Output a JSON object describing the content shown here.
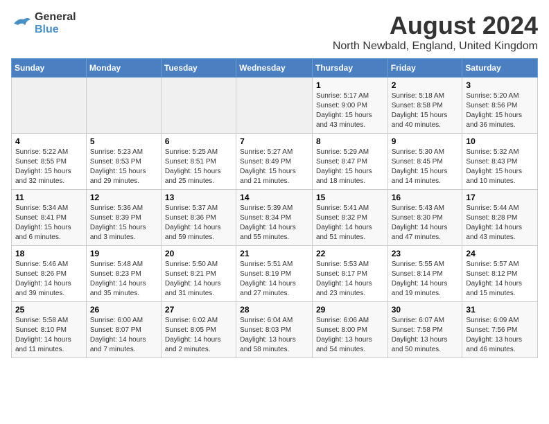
{
  "logo": {
    "line1": "General",
    "line2": "Blue"
  },
  "title": "August 2024",
  "location": "North Newbald, England, United Kingdom",
  "weekdays": [
    "Sunday",
    "Monday",
    "Tuesday",
    "Wednesday",
    "Thursday",
    "Friday",
    "Saturday"
  ],
  "weeks": [
    [
      {
        "day": "",
        "info": ""
      },
      {
        "day": "",
        "info": ""
      },
      {
        "day": "",
        "info": ""
      },
      {
        "day": "",
        "info": ""
      },
      {
        "day": "1",
        "info": "Sunrise: 5:17 AM\nSunset: 9:00 PM\nDaylight: 15 hours\nand 43 minutes."
      },
      {
        "day": "2",
        "info": "Sunrise: 5:18 AM\nSunset: 8:58 PM\nDaylight: 15 hours\nand 40 minutes."
      },
      {
        "day": "3",
        "info": "Sunrise: 5:20 AM\nSunset: 8:56 PM\nDaylight: 15 hours\nand 36 minutes."
      }
    ],
    [
      {
        "day": "4",
        "info": "Sunrise: 5:22 AM\nSunset: 8:55 PM\nDaylight: 15 hours\nand 32 minutes."
      },
      {
        "day": "5",
        "info": "Sunrise: 5:23 AM\nSunset: 8:53 PM\nDaylight: 15 hours\nand 29 minutes."
      },
      {
        "day": "6",
        "info": "Sunrise: 5:25 AM\nSunset: 8:51 PM\nDaylight: 15 hours\nand 25 minutes."
      },
      {
        "day": "7",
        "info": "Sunrise: 5:27 AM\nSunset: 8:49 PM\nDaylight: 15 hours\nand 21 minutes."
      },
      {
        "day": "8",
        "info": "Sunrise: 5:29 AM\nSunset: 8:47 PM\nDaylight: 15 hours\nand 18 minutes."
      },
      {
        "day": "9",
        "info": "Sunrise: 5:30 AM\nSunset: 8:45 PM\nDaylight: 15 hours\nand 14 minutes."
      },
      {
        "day": "10",
        "info": "Sunrise: 5:32 AM\nSunset: 8:43 PM\nDaylight: 15 hours\nand 10 minutes."
      }
    ],
    [
      {
        "day": "11",
        "info": "Sunrise: 5:34 AM\nSunset: 8:41 PM\nDaylight: 15 hours\nand 6 minutes."
      },
      {
        "day": "12",
        "info": "Sunrise: 5:36 AM\nSunset: 8:39 PM\nDaylight: 15 hours\nand 3 minutes."
      },
      {
        "day": "13",
        "info": "Sunrise: 5:37 AM\nSunset: 8:36 PM\nDaylight: 14 hours\nand 59 minutes."
      },
      {
        "day": "14",
        "info": "Sunrise: 5:39 AM\nSunset: 8:34 PM\nDaylight: 14 hours\nand 55 minutes."
      },
      {
        "day": "15",
        "info": "Sunrise: 5:41 AM\nSunset: 8:32 PM\nDaylight: 14 hours\nand 51 minutes."
      },
      {
        "day": "16",
        "info": "Sunrise: 5:43 AM\nSunset: 8:30 PM\nDaylight: 14 hours\nand 47 minutes."
      },
      {
        "day": "17",
        "info": "Sunrise: 5:44 AM\nSunset: 8:28 PM\nDaylight: 14 hours\nand 43 minutes."
      }
    ],
    [
      {
        "day": "18",
        "info": "Sunrise: 5:46 AM\nSunset: 8:26 PM\nDaylight: 14 hours\nand 39 minutes."
      },
      {
        "day": "19",
        "info": "Sunrise: 5:48 AM\nSunset: 8:23 PM\nDaylight: 14 hours\nand 35 minutes."
      },
      {
        "day": "20",
        "info": "Sunrise: 5:50 AM\nSunset: 8:21 PM\nDaylight: 14 hours\nand 31 minutes."
      },
      {
        "day": "21",
        "info": "Sunrise: 5:51 AM\nSunset: 8:19 PM\nDaylight: 14 hours\nand 27 minutes."
      },
      {
        "day": "22",
        "info": "Sunrise: 5:53 AM\nSunset: 8:17 PM\nDaylight: 14 hours\nand 23 minutes."
      },
      {
        "day": "23",
        "info": "Sunrise: 5:55 AM\nSunset: 8:14 PM\nDaylight: 14 hours\nand 19 minutes."
      },
      {
        "day": "24",
        "info": "Sunrise: 5:57 AM\nSunset: 8:12 PM\nDaylight: 14 hours\nand 15 minutes."
      }
    ],
    [
      {
        "day": "25",
        "info": "Sunrise: 5:58 AM\nSunset: 8:10 PM\nDaylight: 14 hours\nand 11 minutes."
      },
      {
        "day": "26",
        "info": "Sunrise: 6:00 AM\nSunset: 8:07 PM\nDaylight: 14 hours\nand 7 minutes."
      },
      {
        "day": "27",
        "info": "Sunrise: 6:02 AM\nSunset: 8:05 PM\nDaylight: 14 hours\nand 2 minutes."
      },
      {
        "day": "28",
        "info": "Sunrise: 6:04 AM\nSunset: 8:03 PM\nDaylight: 13 hours\nand 58 minutes."
      },
      {
        "day": "29",
        "info": "Sunrise: 6:06 AM\nSunset: 8:00 PM\nDaylight: 13 hours\nand 54 minutes."
      },
      {
        "day": "30",
        "info": "Sunrise: 6:07 AM\nSunset: 7:58 PM\nDaylight: 13 hours\nand 50 minutes."
      },
      {
        "day": "31",
        "info": "Sunrise: 6:09 AM\nSunset: 7:56 PM\nDaylight: 13 hours\nand 46 minutes."
      }
    ]
  ]
}
